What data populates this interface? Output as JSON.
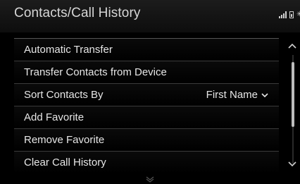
{
  "header": {
    "title": "Contacts/Call History",
    "status_icons": [
      "signal-icon",
      "battery-icon",
      "bluetooth-icon"
    ],
    "bluetooth_glyph": "✳"
  },
  "menu": {
    "items": [
      {
        "label": "Automatic Transfer",
        "value": ""
      },
      {
        "label": "Transfer Contacts from Device",
        "value": ""
      },
      {
        "label": "Sort Contacts By",
        "value": "First Name"
      },
      {
        "label": "Add Favorite",
        "value": ""
      },
      {
        "label": "Remove Favorite",
        "value": ""
      },
      {
        "label": "Clear Call History",
        "value": ""
      }
    ]
  },
  "scrollbar": {
    "icons": [
      "chevron-up-icon",
      "chevron-down-icon"
    ]
  },
  "colors": {
    "background": "#000000",
    "text": "#e6e6e6",
    "divider": "#3a3a3a"
  }
}
